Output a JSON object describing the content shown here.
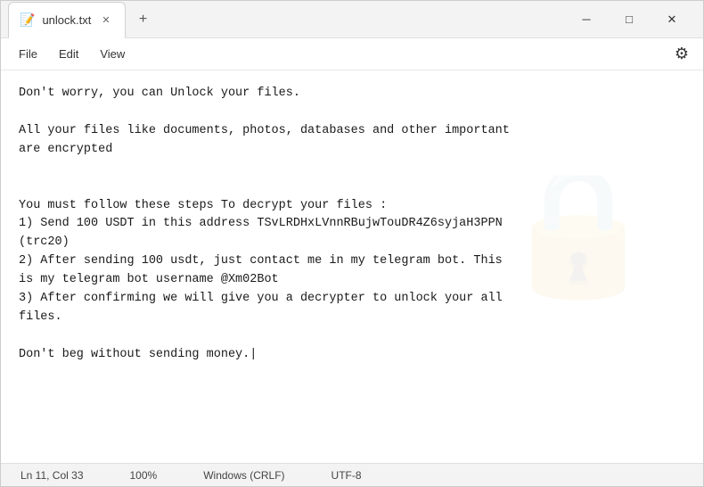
{
  "window": {
    "title": "unlock.txt",
    "icon": "📝"
  },
  "title_bar": {
    "tab_label": "unlock.txt",
    "close_label": "✕",
    "new_tab_label": "+",
    "minimize_label": "─",
    "maximize_label": "□",
    "window_close_label": "✕"
  },
  "menu_bar": {
    "items": [
      "File",
      "Edit",
      "View"
    ],
    "settings_icon": "⚙"
  },
  "editor": {
    "content": "Don't worry, you can Unlock your files.\n\nAll your files like documents, photos, databases and other important\nare encrypted\n\n\nYou must follow these steps To decrypt your files :\n1) Send 100 USDT in this address TSvLRDHxLVnnRBujwTouDR4Z6syjaH3PPN\n(trc20)\n2) After sending 100 usdt, just contact me in my telegram bot. This\nis my telegram bot username @Xm02Bot\n3) After confirming we will give you a decrypter to unlock your all\nfiles.\n\nDon't beg without sending money.|"
  },
  "status_bar": {
    "ln_col": "Ln 11, Col 33",
    "zoom": "100%",
    "line_ending": "Windows (CRLF)",
    "encoding": "UTF-8"
  }
}
